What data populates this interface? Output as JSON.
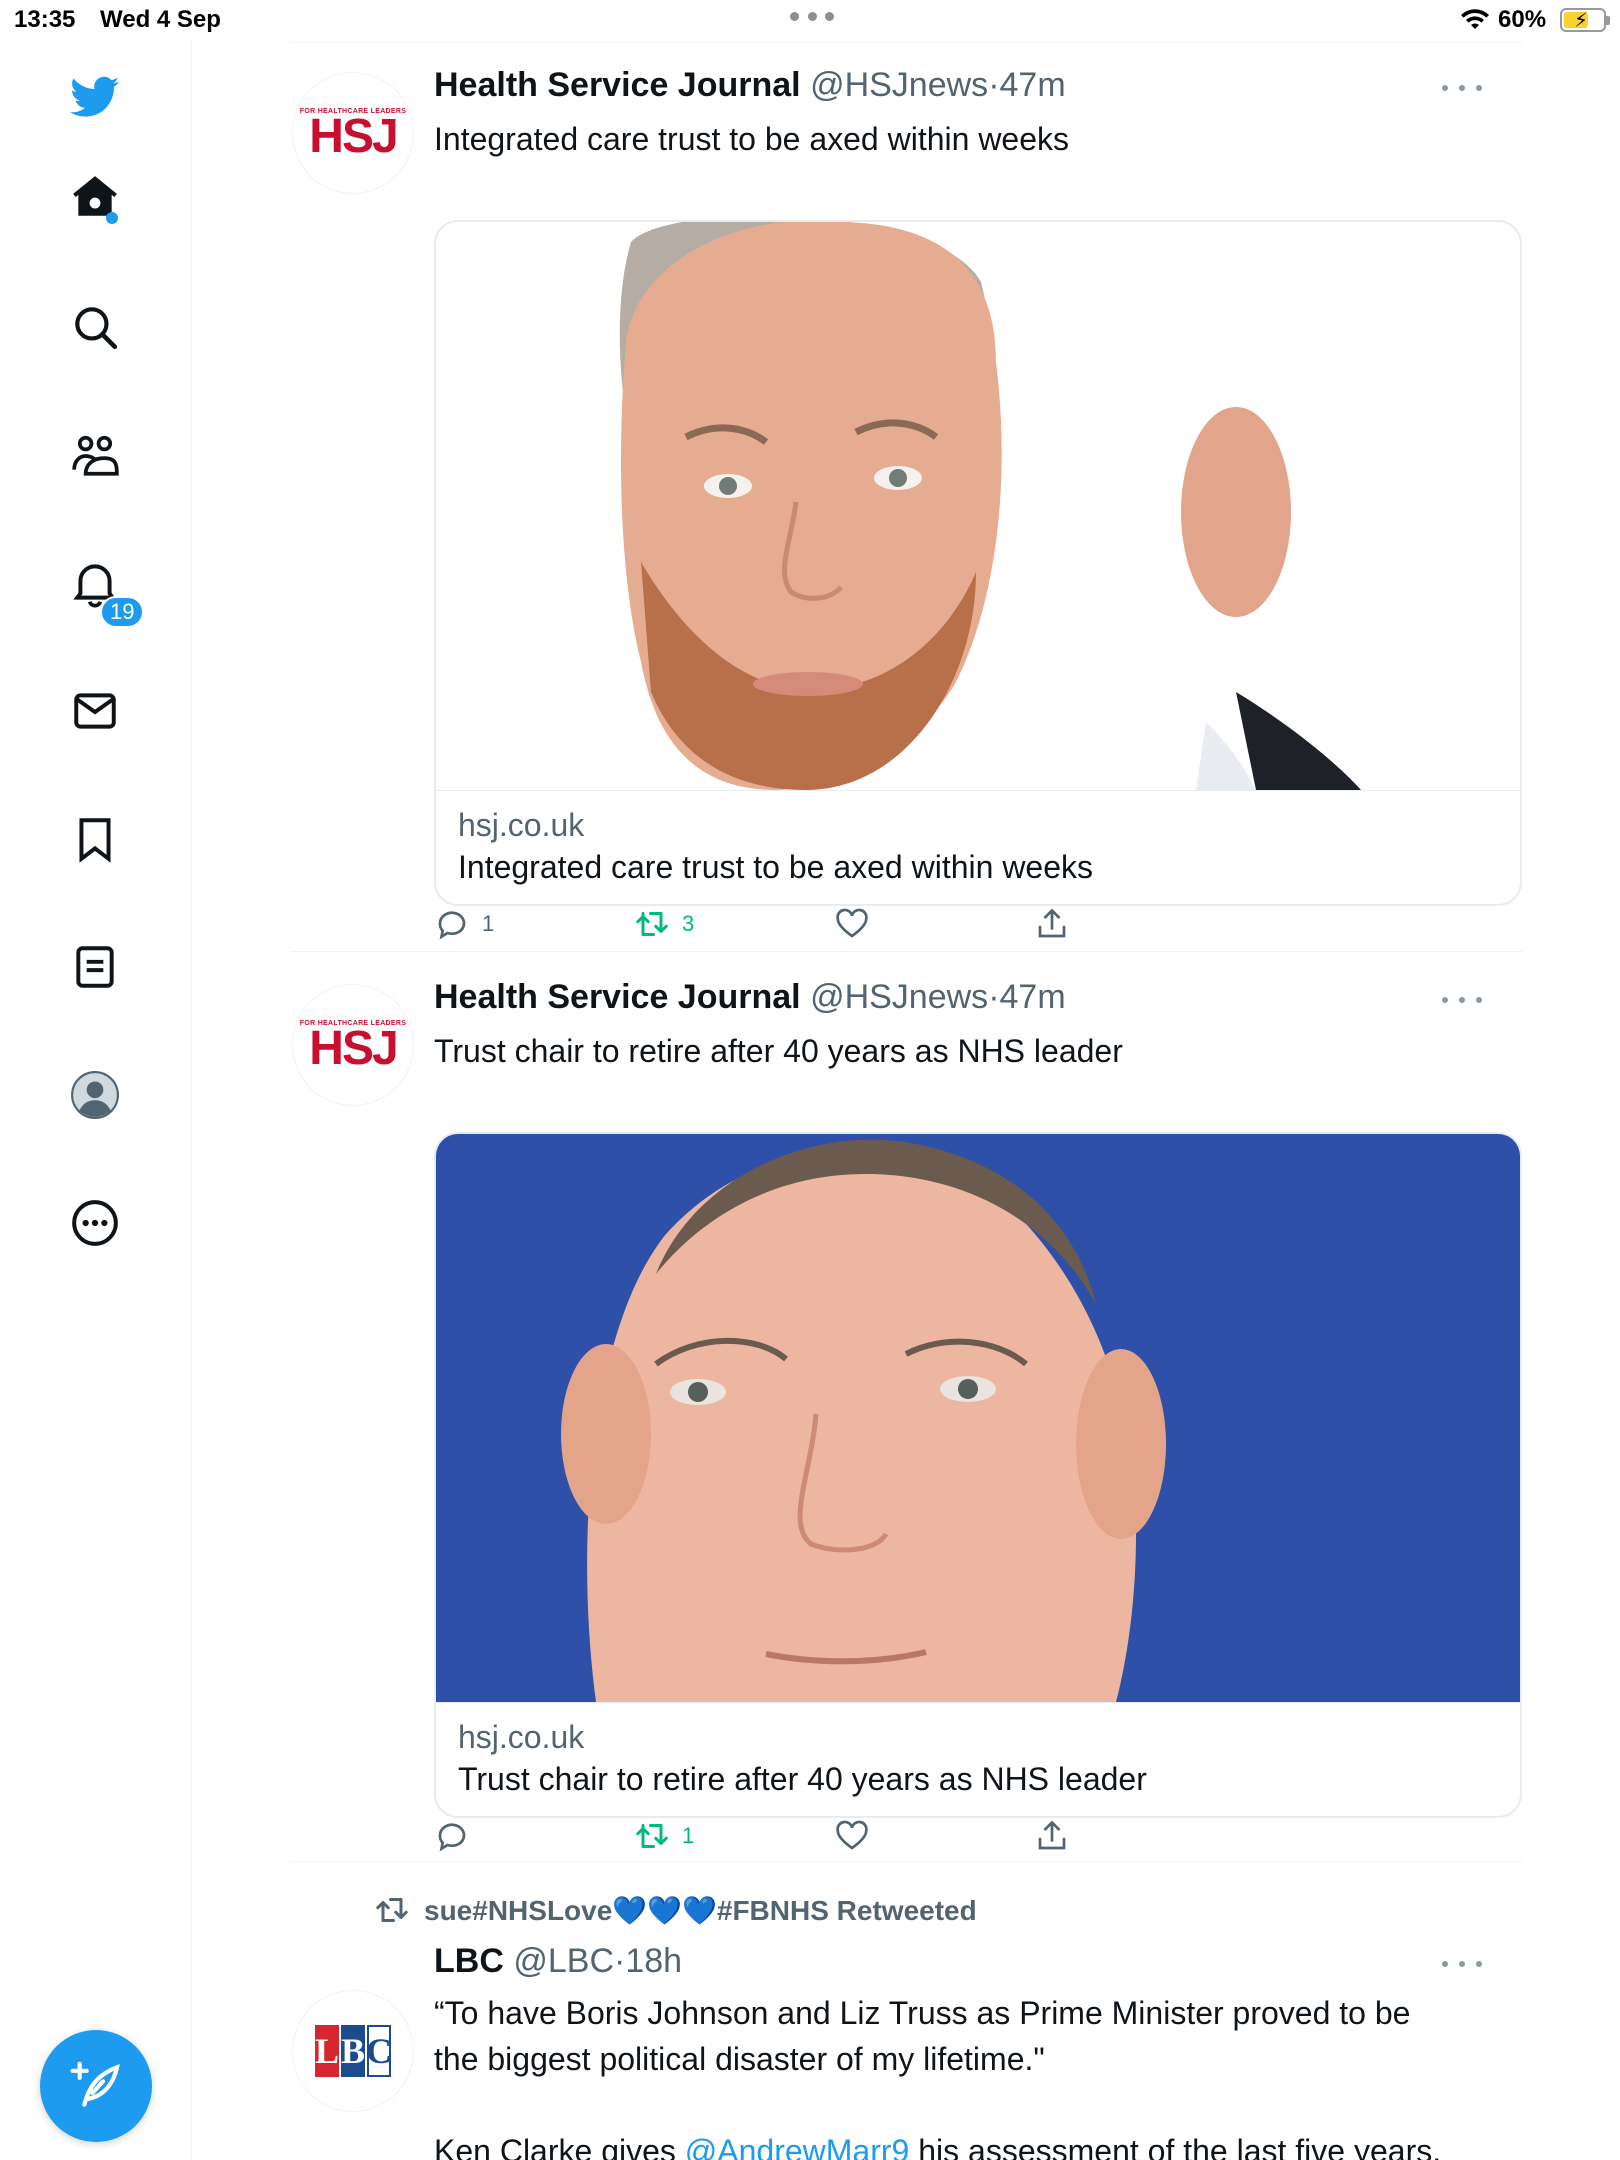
{
  "status_bar": {
    "time": "13:35",
    "date": "Wed 4 Sep",
    "battery_percent": "60%",
    "battery_level": 0.6,
    "charging": true
  },
  "sidebar": {
    "items": [
      {
        "icon": "twitter-logo-icon"
      },
      {
        "icon": "home-icon",
        "has_new_dot": true
      },
      {
        "icon": "search-icon"
      },
      {
        "icon": "communities-icon"
      },
      {
        "icon": "notifications-icon",
        "badge": "19"
      },
      {
        "icon": "messages-icon"
      },
      {
        "icon": "bookmarks-icon"
      },
      {
        "icon": "lists-icon"
      },
      {
        "icon": "profile-avatar-icon"
      },
      {
        "icon": "more-options-icon"
      }
    ],
    "compose_icon": "compose-tweet-icon"
  },
  "tweets": [
    {
      "author": "Health Service Journal",
      "handle": "@HSJnews",
      "dot": "·",
      "time": "47m",
      "avatar_logo": {
        "small": "FOR HEALTHCARE LEADERS",
        "big": "HSJ"
      },
      "text": "Integrated care trust to be axed within weeks",
      "card": {
        "domain": "hsj.co.uk",
        "title": "Integrated care trust to be axed within weeks"
      },
      "replies": "1",
      "retweets": "3",
      "likes": "",
      "retweeted_by_me": true
    },
    {
      "author": "Health Service Journal",
      "handle": "@HSJnews",
      "dot": "·",
      "time": "47m",
      "avatar_logo": {
        "small": "FOR HEALTHCARE LEADERS",
        "big": "HSJ"
      },
      "text": "Trust chair to retire after 40 years as NHS leader",
      "card": {
        "domain": "hsj.co.uk",
        "title": "Trust chair to retire after 40 years as NHS leader"
      },
      "replies": "",
      "retweets": "1",
      "likes": "",
      "retweeted_by_me": true
    },
    {
      "retweeted_by": "sue#NHSLove💙💙💙#FBNHS Retweeted",
      "author": "LBC",
      "handle": "@LBC",
      "dot": "·",
      "time": "18h",
      "avatar_logo": {
        "l": "L",
        "b": "B",
        "c": "C"
      },
      "text_line1": "“To have Boris Johnson and Liz Truss as Prime Minister proved to be",
      "text_line2": "the biggest political disaster of my lifetime.\"",
      "text_line3_pre": "Ken Clarke gives ",
      "text_line3_mention": "@AndrewMarr9",
      "text_line3_post": " his assessment of the last five years."
    }
  ],
  "colors": {
    "accent": "#1d9bf0",
    "retweet_green": "#00ba7c",
    "secondary_text": "#536471",
    "hsj_red": "#c8102e",
    "photo2_background": "#2f50a8"
  }
}
